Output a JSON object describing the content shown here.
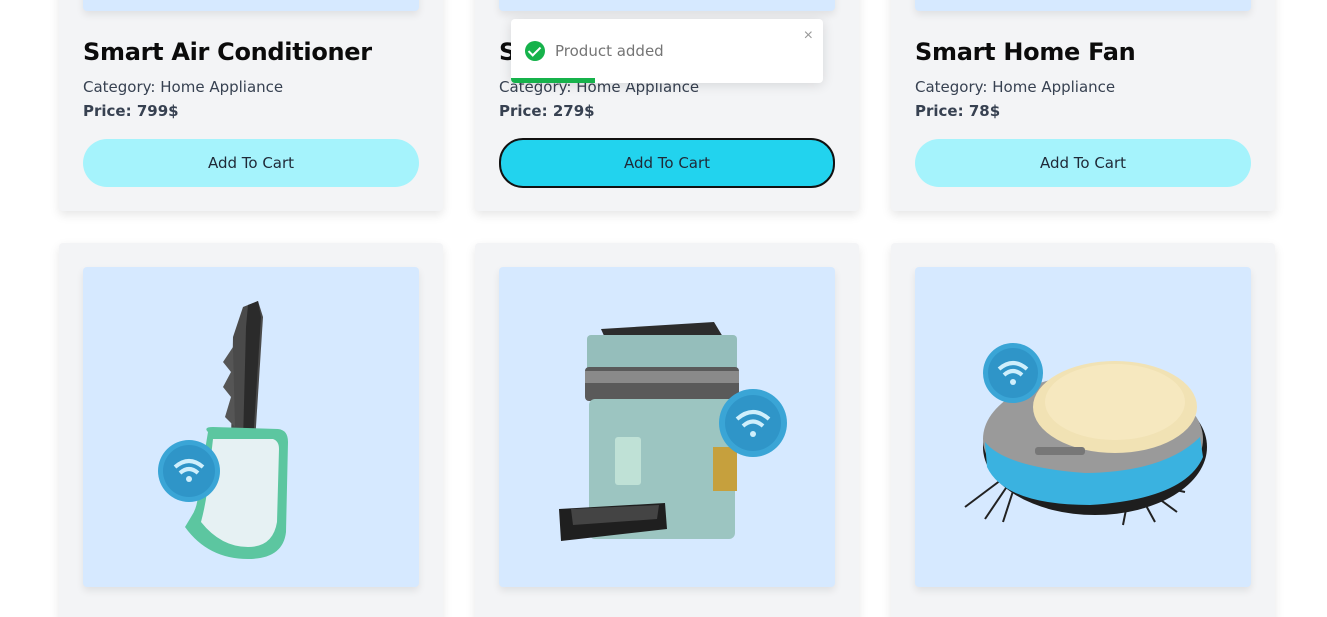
{
  "products_top": [
    {
      "title": "Smart Air Conditioner",
      "category": "Category: Home Appliance",
      "price": "Price: 799$",
      "button": "Add To Cart"
    },
    {
      "title": "S",
      "category": "Category: Home Appliance",
      "price": "Price: 279$",
      "button": "Add To Cart"
    },
    {
      "title": "Smart Home Fan",
      "category": "Category: Home Appliance",
      "price": "Price: 78$",
      "button": "Add To Cart"
    }
  ],
  "products_bottom": [
    {
      "image_icon": "smart-key-icon"
    },
    {
      "image_icon": "smart-pet-feeder-icon"
    },
    {
      "image_icon": "robot-vacuum-icon"
    }
  ],
  "toast": {
    "message": "Product added",
    "close_glyph": "×",
    "progress": 0.27
  },
  "colors": {
    "button": "#a5f3fc",
    "button_active": "#22d3ee",
    "image_bg": "#d6e9ff",
    "success": "#16b24b"
  }
}
